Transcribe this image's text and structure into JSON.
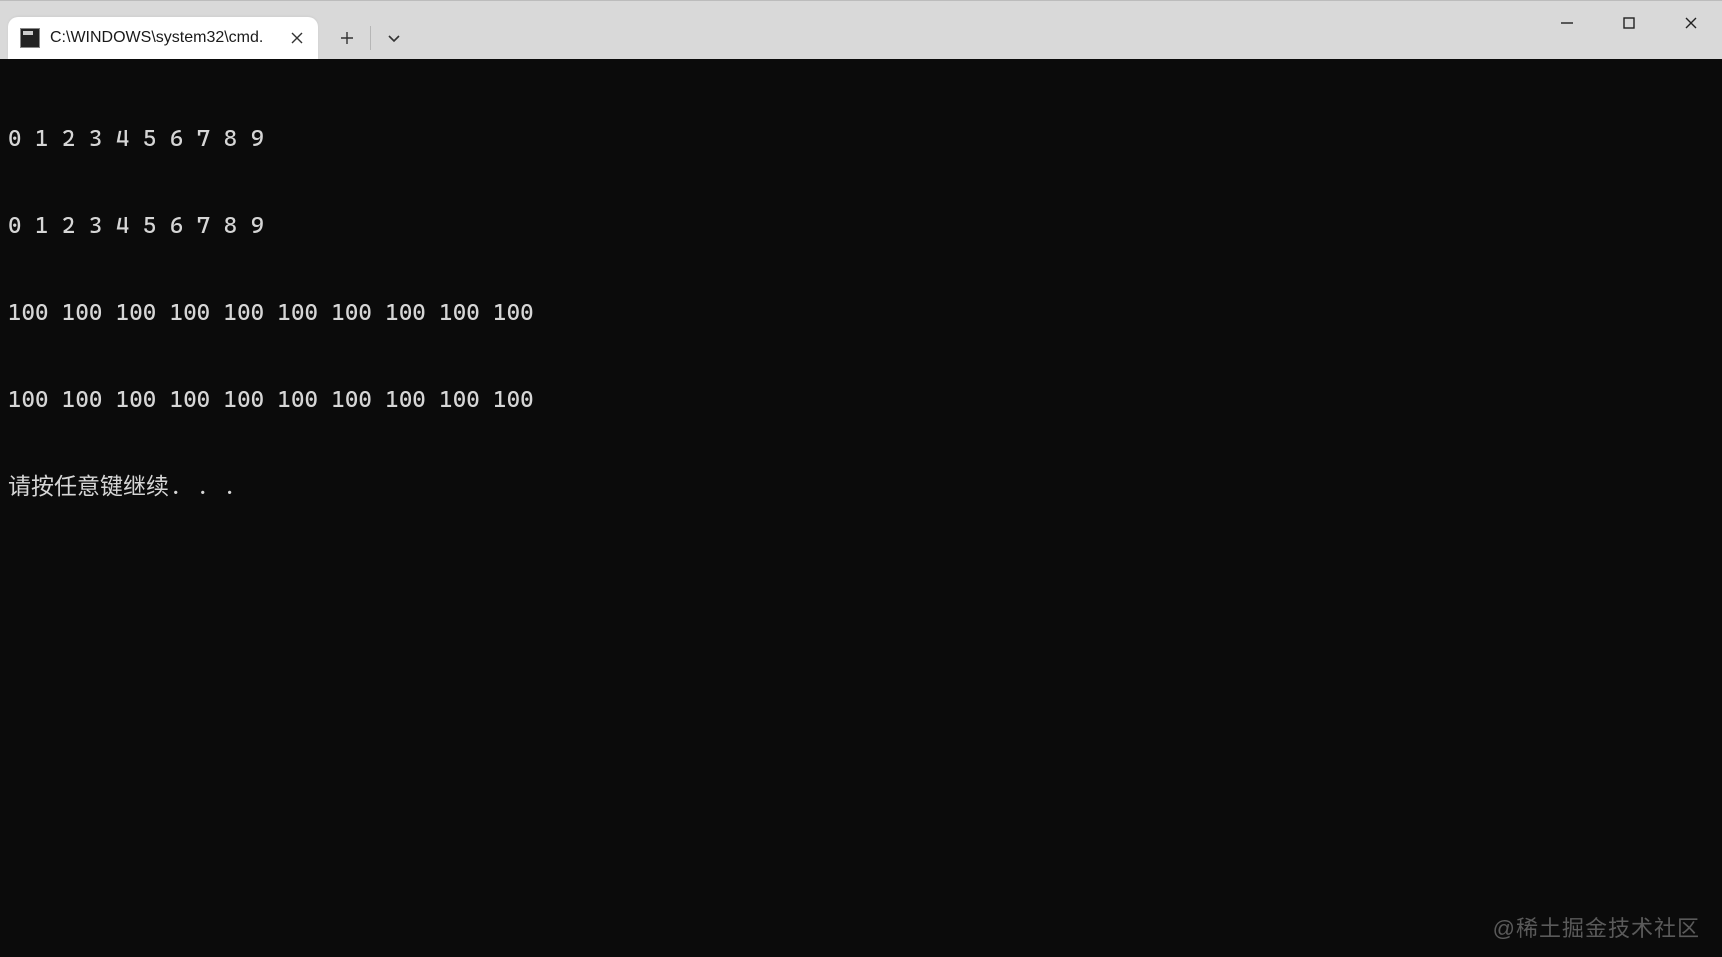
{
  "tab": {
    "title": "C:\\WINDOWS\\system32\\cmd."
  },
  "icons": {
    "close": "close-icon",
    "plus": "plus-icon",
    "chevron": "chevron-down-icon",
    "min": "minimize-icon",
    "max": "maximize-icon",
    "wclose": "window-close-icon"
  },
  "terminal": {
    "lines": [
      "0 1 2 3 4 5 6 7 8 9",
      "0 1 2 3 4 5 6 7 8 9",
      "100 100 100 100 100 100 100 100 100 100",
      "100 100 100 100 100 100 100 100 100 100",
      "请按任意键继续. . ."
    ]
  },
  "watermark": "@稀土掘金技术社区"
}
